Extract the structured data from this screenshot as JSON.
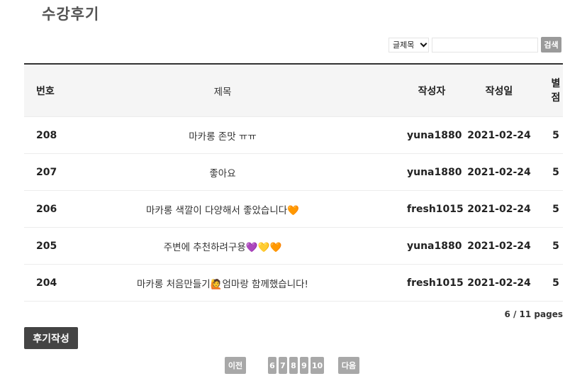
{
  "page": {
    "title": "수강후기"
  },
  "search": {
    "field_selected": "글제목",
    "input_value": "",
    "button_label": "검색"
  },
  "table": {
    "headers": {
      "no": "번호",
      "title": "제목",
      "author": "작성자",
      "date": "작성일",
      "rating": "별점"
    },
    "rows": [
      {
        "no": "208",
        "title": "마카롱 존맛 ㅠㅠ",
        "author": "yuna1880",
        "date": "2021-02-24",
        "rating": "5"
      },
      {
        "no": "207",
        "title": "좋아요",
        "author": "yuna1880",
        "date": "2021-02-24",
        "rating": "5"
      },
      {
        "no": "206",
        "title": "마카롱 색깔이 다양해서 좋았습니다🧡",
        "author": "fresh1015",
        "date": "2021-02-24",
        "rating": "5"
      },
      {
        "no": "205",
        "title": "주변에 추천하려구용💜💛🧡",
        "author": "yuna1880",
        "date": "2021-02-24",
        "rating": "5"
      },
      {
        "no": "204",
        "title": "마카롱 처음만들기🙋엄마랑 함께했습니다!",
        "author": "fresh1015",
        "date": "2021-02-24",
        "rating": "5"
      }
    ]
  },
  "page_info": "6 / 11 pages",
  "write_button": "후기작성",
  "pagination": {
    "prev": "이전",
    "pages": [
      "6",
      "7",
      "8",
      "9",
      "10"
    ],
    "next": "다음"
  }
}
